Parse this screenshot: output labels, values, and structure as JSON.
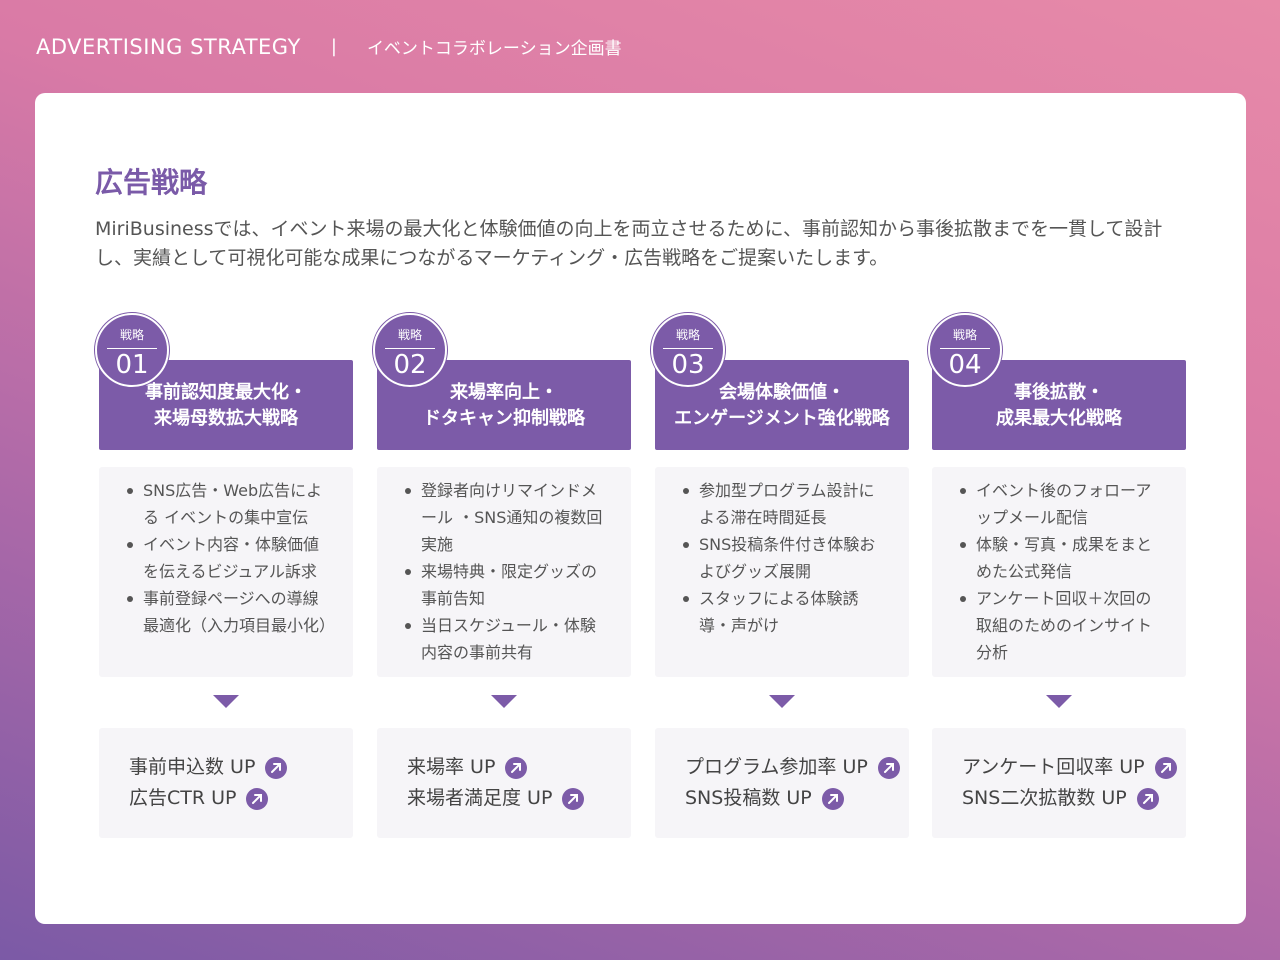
{
  "header": {
    "title": "ADVERTISING STRATEGY",
    "separator": "|",
    "subtitle": "イベントコラボレーション企画書"
  },
  "main": {
    "heading": "広告戦略",
    "intro": "MiriBusinessでは、イベント来場の最大化と体験価値の向上を両立させるために、事前認知から事後拡散までを一貫して設計し、実績として可視化可能な成果につながるマーケティング・広告戦略をご提案いたします。"
  },
  "strategies": [
    {
      "label": "戦略",
      "number": "01",
      "title_line1": "事前認知度最大化・",
      "title_line2": "来場母数拡大戦略",
      "bullets": [
        "SNS広告・Web広告による イベントの集中宣伝",
        "イベント内容・体験価値を伝えるビジュアル訴求",
        "事前登録ページへの導線最適化（入力項目最小化）"
      ],
      "results": [
        "事前申込数 UP",
        "広告CTR UP"
      ]
    },
    {
      "label": "戦略",
      "number": "02",
      "title_line1": "来場率向上・",
      "title_line2": "ドタキャン抑制戦略",
      "bullets": [
        "登録者向けリマインドメール ・SNS通知の複数回実施",
        "来場特典・限定グッズの事前告知",
        "当日スケジュール・体験内容の事前共有"
      ],
      "results": [
        "来場率 UP",
        "来場者満足度 UP"
      ]
    },
    {
      "label": "戦略",
      "number": "03",
      "title_line1": "会場体験価値・",
      "title_line2": "エンゲージメント強化戦略",
      "bullets": [
        "参加型プログラム設計による滞在時間延長",
        "SNS投稿条件付き体験およびグッズ展開",
        "スタッフによる体験誘導・声がけ"
      ],
      "results": [
        "プログラム参加率 UP",
        "SNS投稿数 UP"
      ]
    },
    {
      "label": "戦略",
      "number": "04",
      "title_line1": "事後拡散・",
      "title_line2": "成果最大化戦略",
      "bullets": [
        "イベント後のフォローアップメール配信",
        "体験・写真・成果をまとめた公式発信",
        "アンケート回収＋次回の取組のためのインサイト分析"
      ],
      "results": [
        "アンケート回収率 UP",
        "SNS二次拡散数 UP"
      ]
    }
  ],
  "colors": {
    "accent": "#7c5ba8",
    "panel": "#f6f5f8",
    "heading": "#7a5aa8"
  }
}
